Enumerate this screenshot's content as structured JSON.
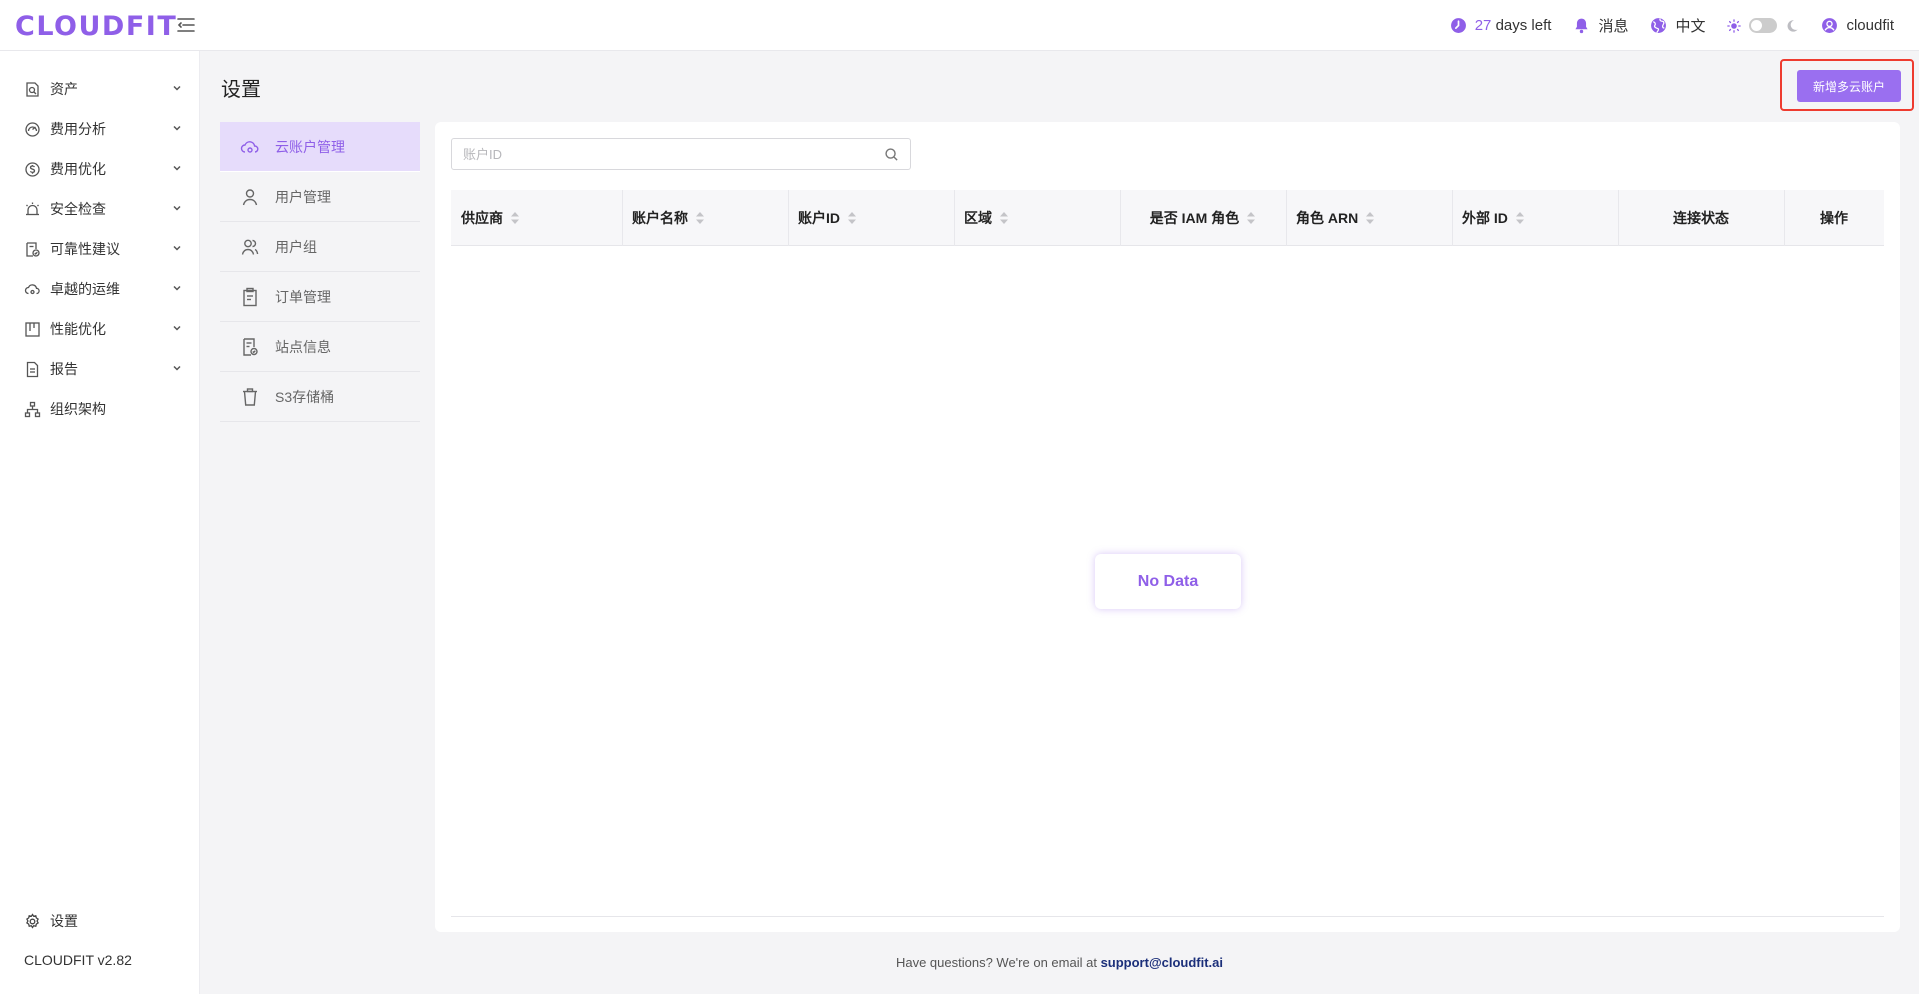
{
  "app": {
    "logo": "CLOUDFIT",
    "version": "CLOUDFIT v2.82"
  },
  "header": {
    "trial_days": "27",
    "trial_suffix": "days left",
    "messages": "消息",
    "language": "中文",
    "username": "cloudfit"
  },
  "sidebar": {
    "items": [
      {
        "label": "资产",
        "icon": "asset-search-icon"
      },
      {
        "label": "费用分析",
        "icon": "dashboard-gauge-icon"
      },
      {
        "label": "费用优化",
        "icon": "dollar-circle-icon"
      },
      {
        "label": "安全检查",
        "icon": "alarm-icon"
      },
      {
        "label": "可靠性建议",
        "icon": "document-check-icon"
      },
      {
        "label": "卓越的运维",
        "icon": "cloud-ops-icon"
      },
      {
        "label": "性能优化",
        "icon": "performance-board-icon"
      },
      {
        "label": "报告",
        "icon": "report-document-icon"
      },
      {
        "label": "组织架构",
        "icon": "org-chart-icon"
      }
    ],
    "settings_label": "设置"
  },
  "page": {
    "title": "设置",
    "add_button": "新增多云账户"
  },
  "settings_nav": [
    {
      "label": "云账户管理",
      "icon": "cloud-account-icon",
      "active": true
    },
    {
      "label": "用户管理",
      "icon": "user-icon"
    },
    {
      "label": "用户组",
      "icon": "user-group-icon"
    },
    {
      "label": "订单管理",
      "icon": "order-clipboard-icon"
    },
    {
      "label": "站点信息",
      "icon": "site-info-icon"
    },
    {
      "label": "S3存储桶",
      "icon": "bucket-icon"
    }
  ],
  "table": {
    "search_placeholder": "账户ID",
    "columns": [
      "供应商",
      "账户名称",
      "账户ID",
      "区域",
      "是否 IAM 角色",
      "角色 ARN",
      "外部 ID",
      "连接状态",
      "操作"
    ],
    "empty_text": "No Data"
  },
  "footer": {
    "text": "Have questions? We're on email at",
    "email": "support@cloudfit.ai"
  },
  "colors": {
    "accent": "#8f5fe8",
    "button": "#9a6ff0",
    "highlight_frame": "#ee3b2f",
    "active_bg": "#e6dcfb"
  }
}
